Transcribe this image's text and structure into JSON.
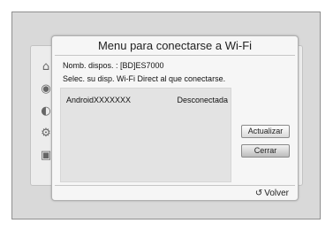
{
  "dialog": {
    "title": "Menu para conectarse a Wi-Fi",
    "device_name_line": "Nomb. dispos. : [BD]ES7000",
    "instruction": "Selec. su disp. Wi-Fi Direct al que conectarse."
  },
  "devices": [
    {
      "name": "AndroidXXXXXXX",
      "status": "Desconectada"
    }
  ],
  "buttons": {
    "refresh": "Actualizar",
    "close": "Cerrar"
  },
  "footer": {
    "back_icon": "↺",
    "back_label": "Volver"
  },
  "sidebar_icons": [
    "home-icon",
    "disc-icon",
    "globe-icon",
    "gear-icon",
    "help-icon"
  ]
}
